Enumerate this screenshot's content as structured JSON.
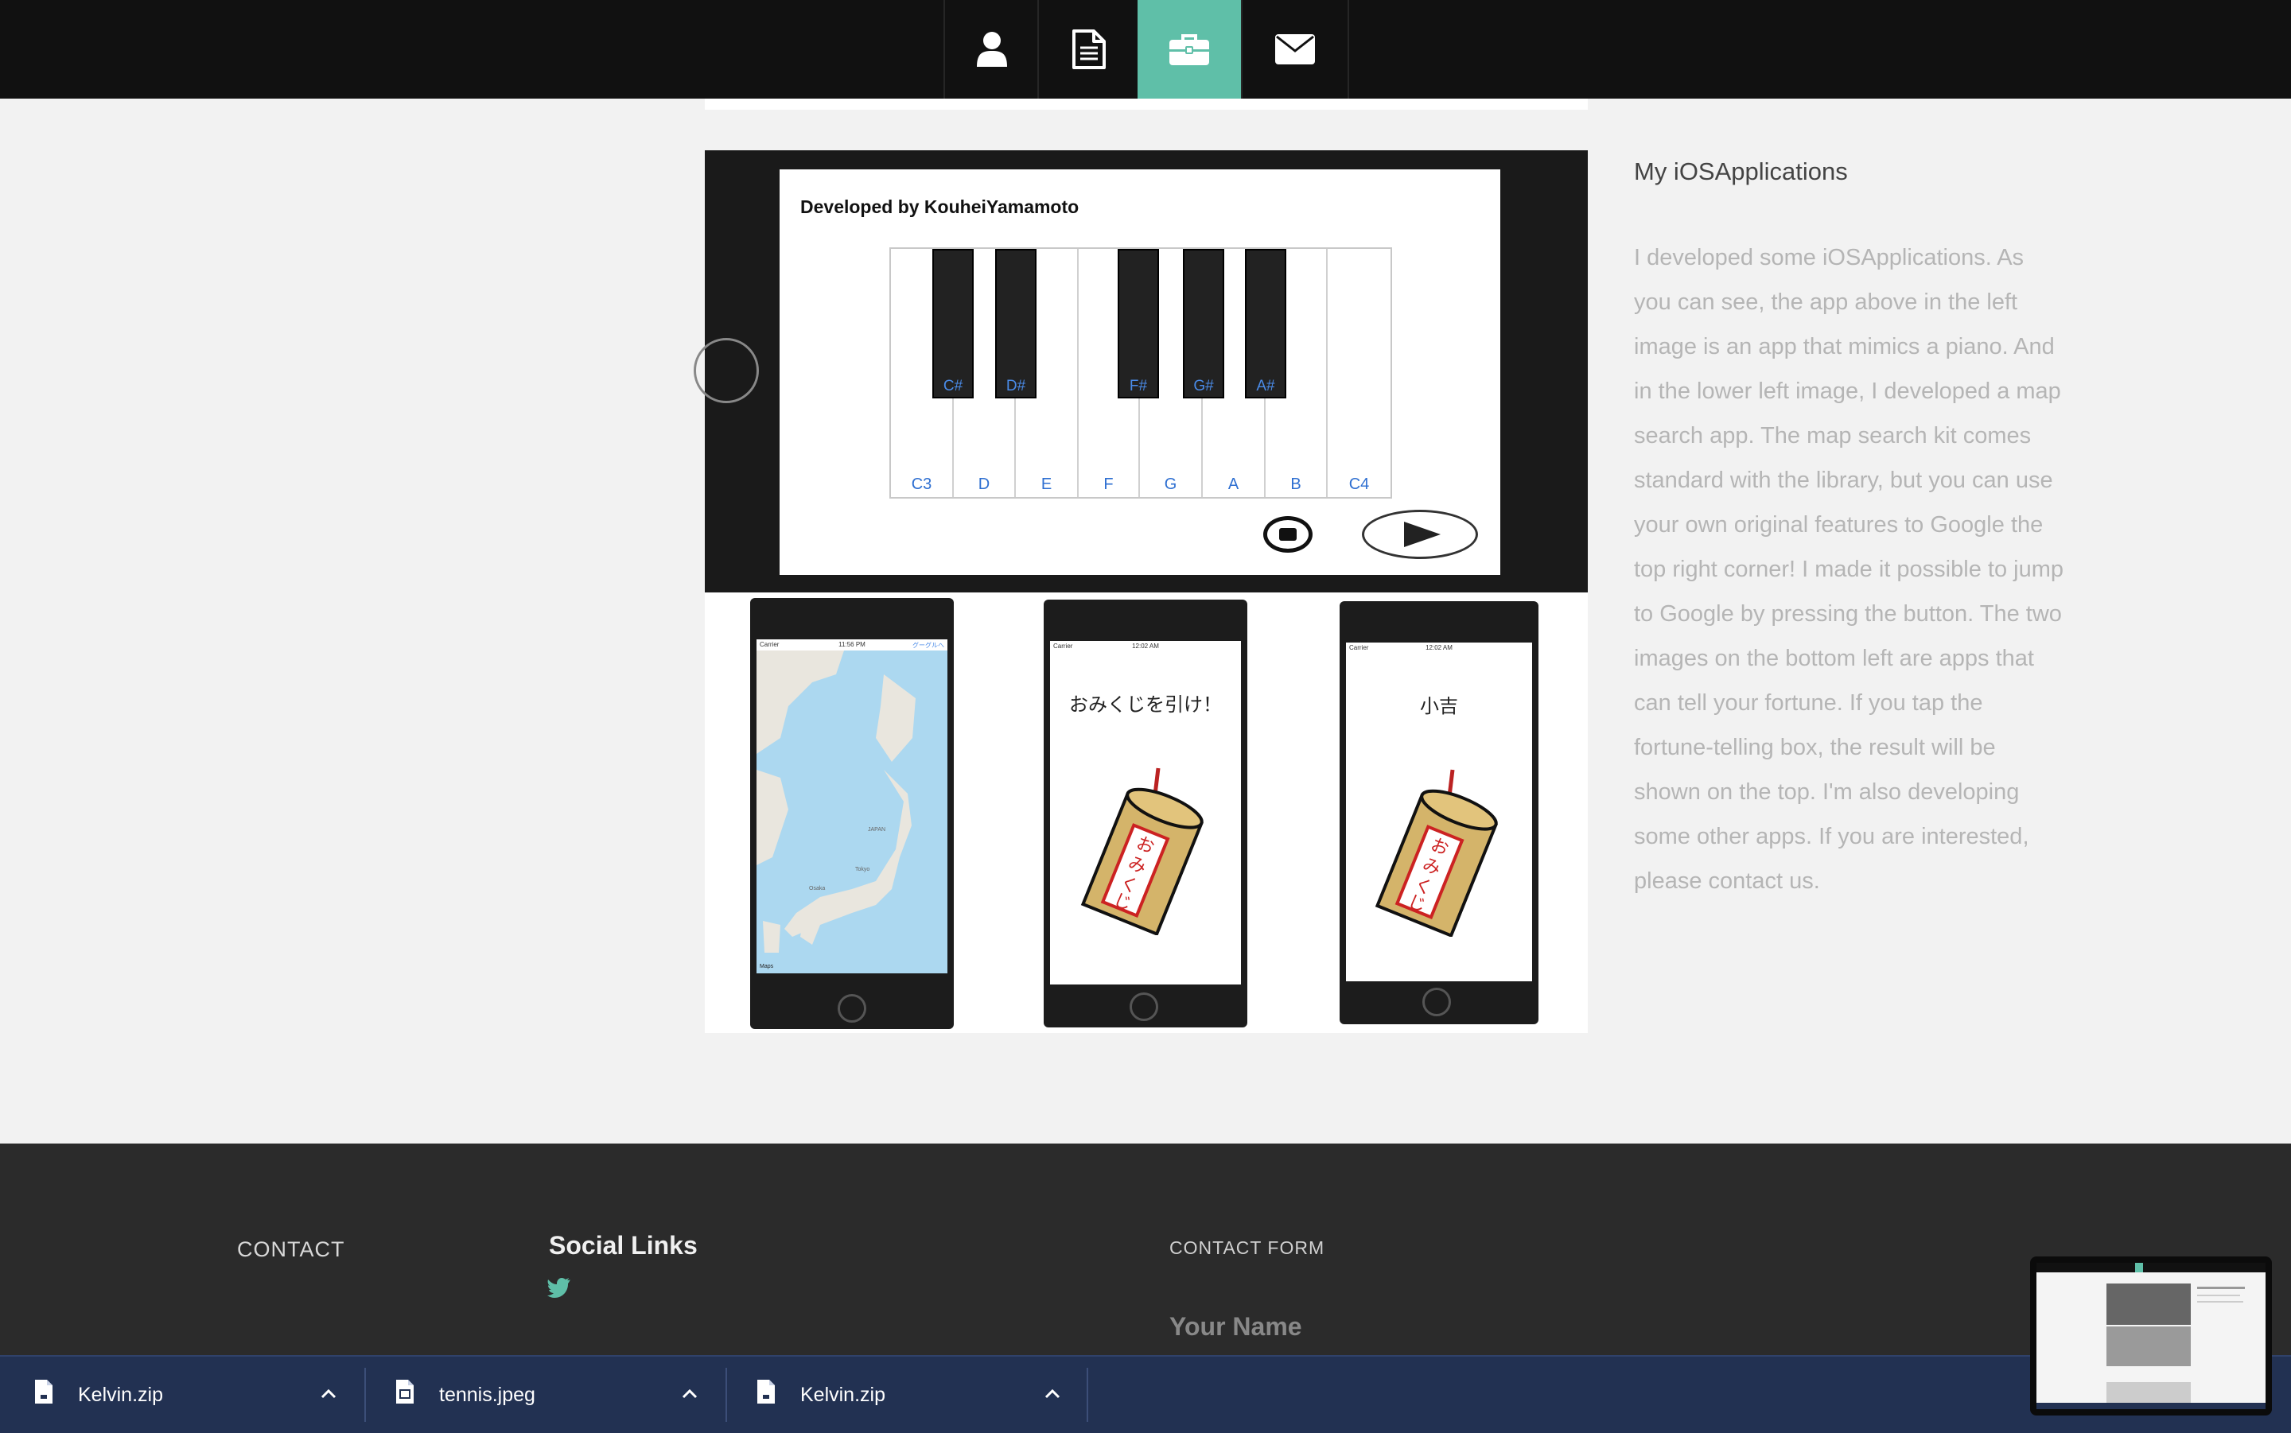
{
  "nav": {
    "items": [
      {
        "icon": "user-icon",
        "active": false
      },
      {
        "icon": "document-icon",
        "active": false
      },
      {
        "icon": "briefcase-icon",
        "active": true
      },
      {
        "icon": "envelope-icon",
        "active": false
      }
    ],
    "active_color": "#5fbfa8"
  },
  "piano_app": {
    "developer_label": "Developed by KouheiYamamoto",
    "white_keys": [
      "C3",
      "D",
      "E",
      "F",
      "G",
      "A",
      "B",
      "C4"
    ],
    "black_keys": [
      "C#",
      "D#",
      "F#",
      "G#",
      "A#"
    ]
  },
  "phones": {
    "map": {
      "carrier": "Carrier",
      "time": "11:56 PM",
      "link": "グーグルへ",
      "label_japan": "JAPAN",
      "label_tokyo": "Tokyo",
      "label_osaka": "Osaka",
      "maps_label": "Maps"
    },
    "omikuji1": {
      "carrier": "Carrier",
      "time": "12:02 AM",
      "title": "おみくじを引け！",
      "box_label": "おみくじ"
    },
    "omikuji2": {
      "carrier": "Carrier",
      "time": "12:02 AM",
      "title": "小吉",
      "box_label": "おみくじ"
    }
  },
  "sidebar": {
    "title": "My iOSApplications",
    "body": "I developed some iOSApplications. As you can see, the app above in the left image is an app that mimics a piano. And in the lower left image, I developed a map search app. The map search kit comes standard with the library, but you can use your own original features to Google the top right corner! I made it possible to jump to Google by pressing the button. The two images on the bottom left are apps that can tell your fortune. If you tap the fortune-telling box, the result will be shown on the top. I'm also developing some other apps. If you are interested, please contact us."
  },
  "footer": {
    "contact_heading": "CONTACT",
    "social_heading": "Social Links",
    "social_icons": [
      "twitter-icon"
    ],
    "form_heading": "CONTACT FORM",
    "name_placeholder": "Your Name"
  },
  "downloads": [
    {
      "file": "Kelvin.zip",
      "icon": "zip-file-icon"
    },
    {
      "file": "tennis.jpeg",
      "icon": "image-file-icon"
    },
    {
      "file": "Kelvin.zip",
      "icon": "zip-file-icon"
    }
  ]
}
